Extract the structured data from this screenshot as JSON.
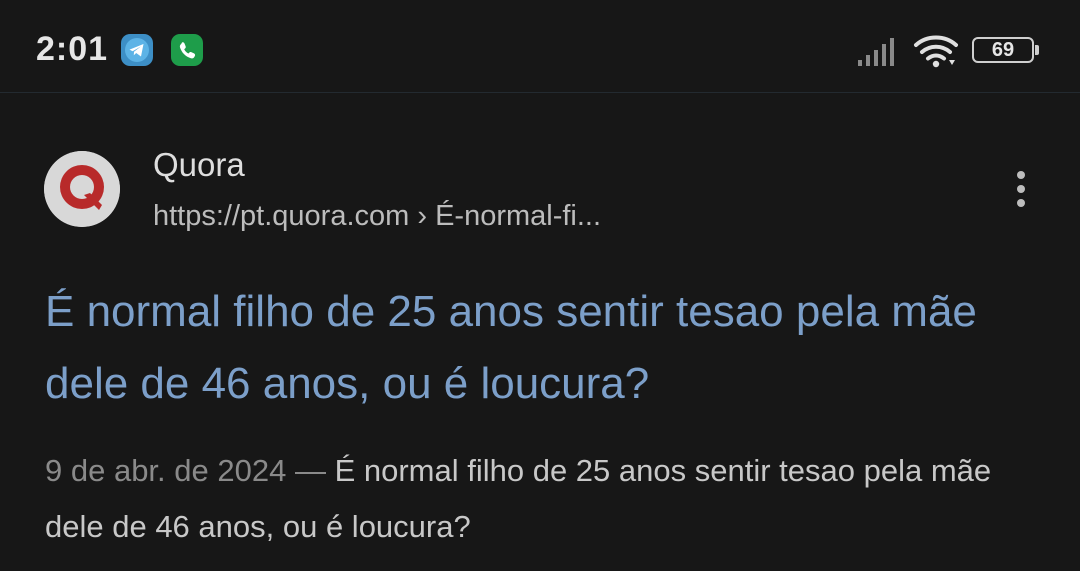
{
  "status_bar": {
    "time": "2:01",
    "battery_level": "69",
    "notifications": [
      "telegram-icon",
      "phone-call-icon"
    ],
    "icons": [
      "signal-icon",
      "wifi-icon",
      "battery-icon"
    ]
  },
  "result": {
    "site_name": "Quora",
    "url": "https://pt.quora.com › É-normal-fi...",
    "title": "É normal filho de 25 anos sentir tesao pela mãe dele de 46 anos, ou é loucura?",
    "snippet_date": "9 de abr. de 2024 — ",
    "snippet_text": "É normal filho de 25 anos sentir tesao pela mãe dele de 46 anos, ou é loucura?",
    "favicon": "quora-logo-icon",
    "menu_icon": "more-vert-icon"
  },
  "colors": {
    "background": "#171717",
    "title_link": "#7c9fc9",
    "text": "#c8c8c8",
    "telegram": "#3d8fc6",
    "phone_app": "#1e9d4a"
  }
}
